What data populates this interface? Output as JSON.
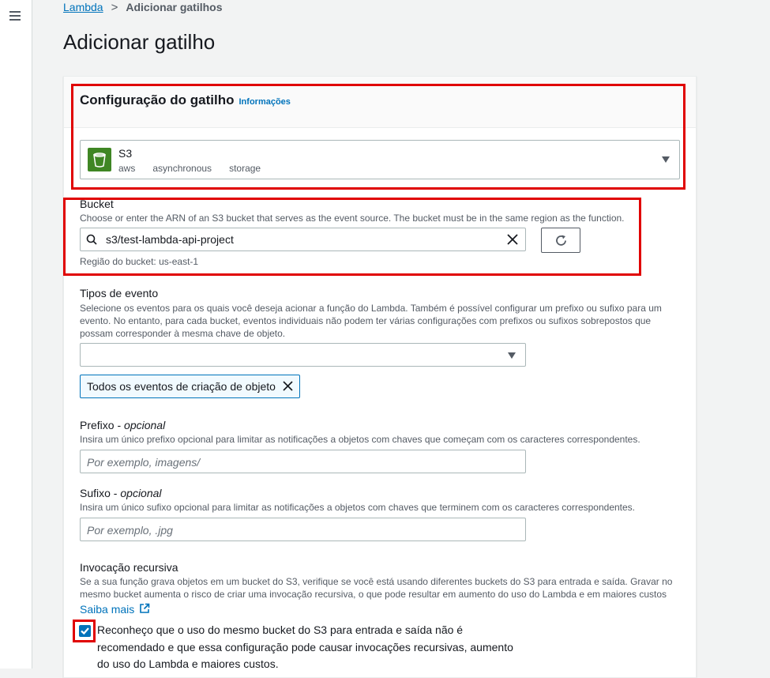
{
  "breadcrumb": {
    "root": "Lambda",
    "current": "Adicionar gatilhos"
  },
  "page": {
    "title": "Adicionar gatilho"
  },
  "trigger_config": {
    "title": "Configuração do gatilho",
    "info_link": "Informações",
    "source": {
      "name": "S3",
      "tags": [
        "aws",
        "asynchronous",
        "storage"
      ]
    }
  },
  "bucket": {
    "label": "Bucket",
    "description": "Choose or enter the ARN of an S3 bucket that serves as the event source. The bucket must be in the same region as the function.",
    "value": "s3/test-lambda-api-project",
    "region_note": "Região do bucket: us-east-1"
  },
  "event_types": {
    "label": "Tipos de evento",
    "description": "Selecione os eventos para os quais você deseja acionar a função do Lambda. Também é possível configurar um prefixo ou sufixo para um evento. No entanto, para cada bucket, eventos individuais não podem ter várias configurações com prefixos ou sufixos sobrepostos que possam corresponder à mesma chave de objeto.",
    "selected_token": "Todos os eventos de criação de objeto"
  },
  "prefix": {
    "label": "Prefixo",
    "optional": "opcional",
    "description": "Insira um único prefixo opcional para limitar as notificações a objetos com chaves que começam com os caracteres correspondentes.",
    "placeholder": "Por exemplo, imagens/"
  },
  "suffix": {
    "label": "Sufixo",
    "optional": "opcional",
    "description": "Insira um único sufixo opcional para limitar as notificações a objetos com chaves que terminem com os caracteres correspondentes.",
    "placeholder": "Por exemplo, .jpg"
  },
  "recursive": {
    "label": "Invocação recursiva",
    "description": "Se a sua função grava objetos em um bucket do S3, verifique se você está usando diferentes buckets do S3 para entrada e saída. Gravar no mesmo bucket aumenta o risco de criar uma invocação recursiva, o que pode resultar em aumento do uso do Lambda e em maiores custos",
    "learn_more": "Saiba mais",
    "ack_checked": true,
    "ack_text": "Reconheço que o uso do mesmo bucket do S3 para entrada e saída não é recomendado e que essa configuração pode causar invocações recursivas, aumento do uso do Lambda e maiores custos."
  },
  "colors": {
    "link": "#0073bb",
    "highlight": "#e00000",
    "s3_icon": "#3f8624"
  }
}
